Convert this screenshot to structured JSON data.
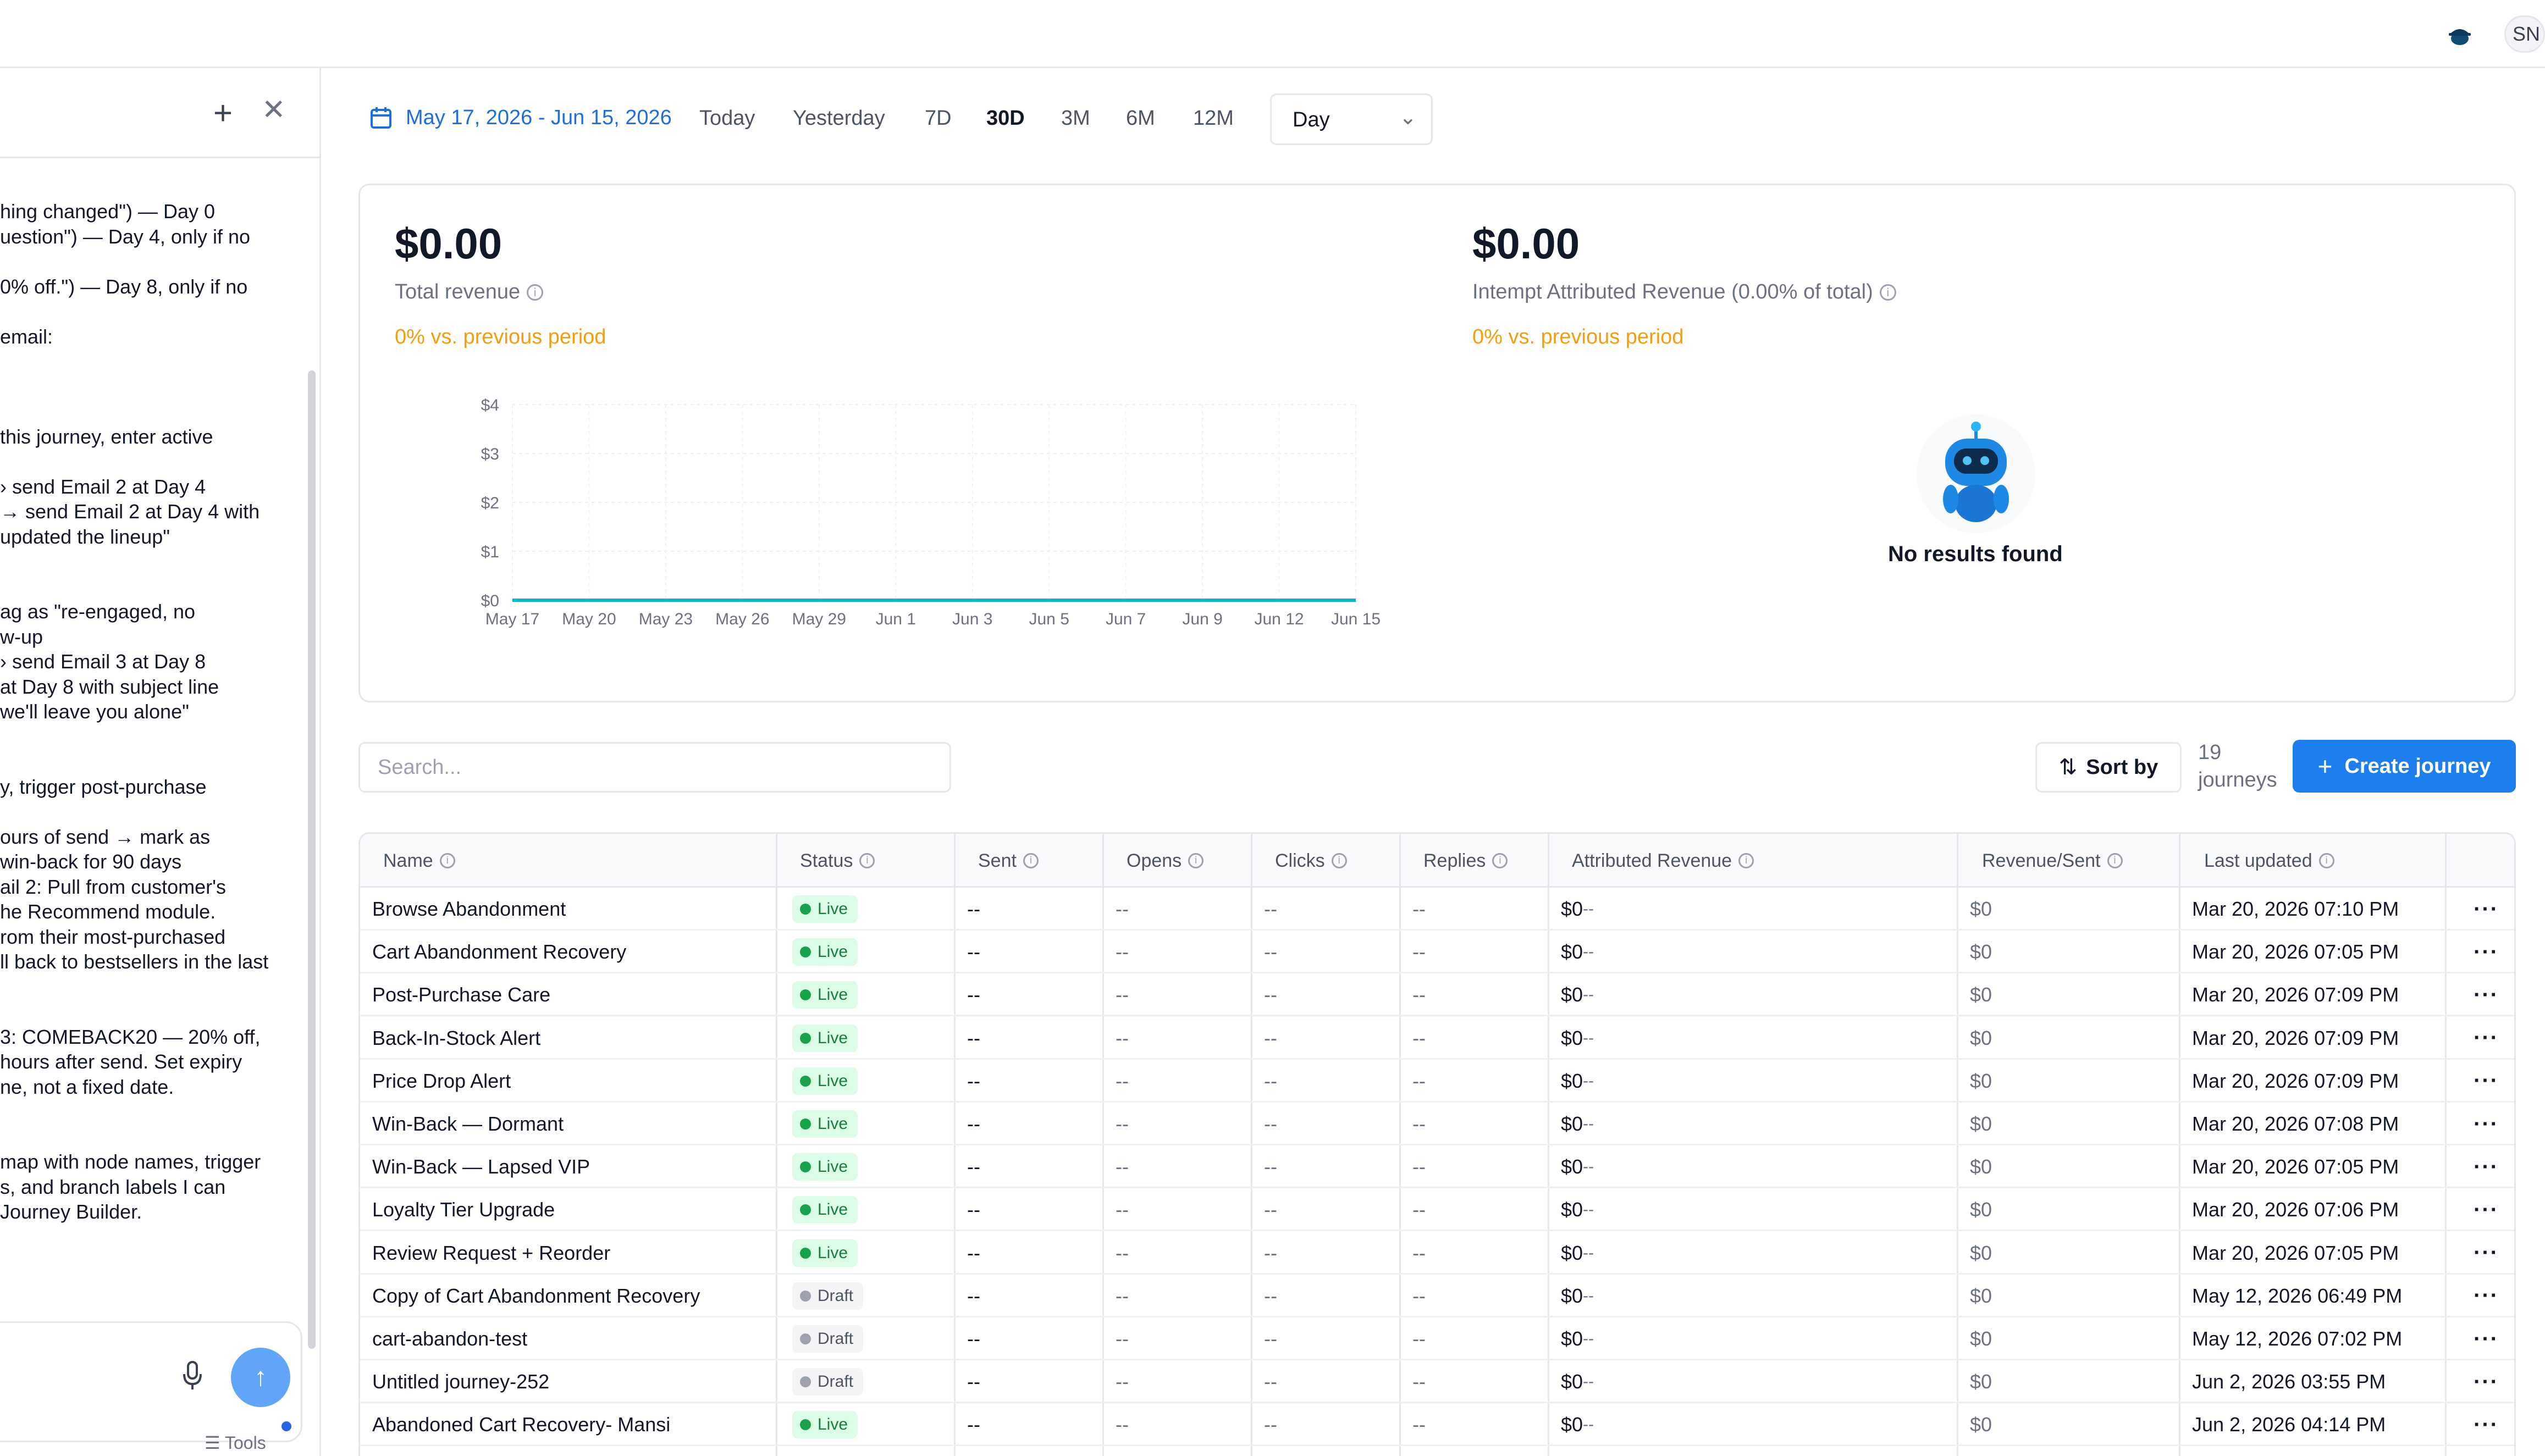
{
  "topbar": {
    "avatar_initials": "SN",
    "bot_icon": "robot-hat-icon"
  },
  "chat": {
    "new_icon": "plus-icon",
    "close_icon": "close-icon",
    "lines": [
      "hing changed\") — Day 0",
      "uestion\") — Day 4, only if no",
      "",
      "0% off.\") — Day 8, only if no",
      "",
      "email:",
      "",
      "",
      "",
      " this journey, enter active",
      "",
      "› send Email 2 at Day 4",
      "→ send Email 2 at Day 4 with",
      " updated the lineup\"",
      "",
      "",
      "ag as \"re-engaged, no",
      "w-up",
      "› send Email 3 at Day 8",
      " at Day 8 with subject line",
      "we'll leave you alone\"",
      "",
      "",
      "y, trigger post-purchase",
      "",
      "ours of send → mark as",
      " win-back for 90 days",
      "ail 2: Pull from customer's",
      "he Recommend module.",
      "rom their most-purchased",
      "ll back to bestsellers in the last",
      "",
      "",
      "3: COMEBACK20 — 20% off,",
      " hours after send. Set expiry",
      "ne, not a fixed date.",
      "",
      "",
      "map with node names, trigger",
      "s, and branch labels I can",
      " Journey Builder."
    ],
    "mic_icon": "microphone-icon",
    "send_icon": "arrow-up-icon",
    "tools_label": "Tools"
  },
  "toolbar": {
    "date_range": "May 17, 2026 - Jun 15, 2026",
    "ranges": [
      "Today",
      "Yesterday",
      "7D",
      "30D",
      "3M",
      "6M",
      "12M"
    ],
    "active_range": "30D",
    "granularity": "Day"
  },
  "stats": {
    "total_revenue": "$0.00",
    "total_revenue_label": "Total revenue",
    "total_revenue_delta": "0% vs. previous period",
    "attributed_revenue": "$0.00",
    "attributed_revenue_label": "Intempt Attributed Revenue (0.00% of total)",
    "attributed_revenue_delta": "0% vs. previous period",
    "no_results": "No results found"
  },
  "chart_data": {
    "type": "line",
    "x": [
      "May 17",
      "May 20",
      "May 23",
      "May 26",
      "May 29",
      "Jun 1",
      "Jun 3",
      "Jun 5",
      "Jun 7",
      "Jun 9",
      "Jun 12",
      "Jun 15"
    ],
    "y_ticks": [
      "$0",
      "$1",
      "$2",
      "$3",
      "$4"
    ],
    "series": [
      {
        "values": [
          0,
          0,
          0,
          0,
          0,
          0,
          0,
          0,
          0,
          0,
          0,
          0
        ]
      }
    ],
    "ylim": [
      0,
      4
    ],
    "grid": true,
    "line_color": "#06b6d4"
  },
  "search": {
    "placeholder": "Search..."
  },
  "actions": {
    "sort_label": "Sort by",
    "count_number": "19",
    "count_label": "journeys",
    "create_label": "Create journey"
  },
  "table": {
    "headers": [
      "Name",
      "Status",
      "Sent",
      "Opens",
      "Clicks",
      "Replies",
      "Attributed Revenue",
      "Revenue/Sent",
      "Last updated"
    ],
    "rows": [
      {
        "name": "Browse Abandonment",
        "status": "Live",
        "sent": "--",
        "opens": "--",
        "clicks": "--",
        "replies": "--",
        "rev": "$0",
        "rev_delta": "--",
        "rps": "$0",
        "updated": "Mar 20, 2026 07:10 PM"
      },
      {
        "name": "Cart Abandonment Recovery",
        "status": "Live",
        "sent": "--",
        "opens": "--",
        "clicks": "--",
        "replies": "--",
        "rev": "$0",
        "rev_delta": "--",
        "rps": "$0",
        "updated": "Mar 20, 2026 07:05 PM"
      },
      {
        "name": "Post-Purchase Care",
        "status": "Live",
        "sent": "--",
        "opens": "--",
        "clicks": "--",
        "replies": "--",
        "rev": "$0",
        "rev_delta": "--",
        "rps": "$0",
        "updated": "Mar 20, 2026 07:09 PM"
      },
      {
        "name": "Back-In-Stock Alert",
        "status": "Live",
        "sent": "--",
        "opens": "--",
        "clicks": "--",
        "replies": "--",
        "rev": "$0",
        "rev_delta": "--",
        "rps": "$0",
        "updated": "Mar 20, 2026 07:09 PM"
      },
      {
        "name": "Price Drop Alert",
        "status": "Live",
        "sent": "--",
        "opens": "--",
        "clicks": "--",
        "replies": "--",
        "rev": "$0",
        "rev_delta": "--",
        "rps": "$0",
        "updated": "Mar 20, 2026 07:09 PM"
      },
      {
        "name": "Win-Back — Dormant",
        "status": "Live",
        "sent": "--",
        "opens": "--",
        "clicks": "--",
        "replies": "--",
        "rev": "$0",
        "rev_delta": "--",
        "rps": "$0",
        "updated": "Mar 20, 2026 07:08 PM"
      },
      {
        "name": "Win-Back — Lapsed VIP",
        "status": "Live",
        "sent": "--",
        "opens": "--",
        "clicks": "--",
        "replies": "--",
        "rev": "$0",
        "rev_delta": "--",
        "rps": "$0",
        "updated": "Mar 20, 2026 07:05 PM"
      },
      {
        "name": "Loyalty Tier Upgrade",
        "status": "Live",
        "sent": "--",
        "opens": "--",
        "clicks": "--",
        "replies": "--",
        "rev": "$0",
        "rev_delta": "--",
        "rps": "$0",
        "updated": "Mar 20, 2026 07:06 PM"
      },
      {
        "name": "Review Request + Reorder",
        "status": "Live",
        "sent": "--",
        "opens": "--",
        "clicks": "--",
        "replies": "--",
        "rev": "$0",
        "rev_delta": "--",
        "rps": "$0",
        "updated": "Mar 20, 2026 07:05 PM"
      },
      {
        "name": "Copy of Cart Abandonment Recovery",
        "status": "Draft",
        "sent": "--",
        "opens": "--",
        "clicks": "--",
        "replies": "--",
        "rev": "$0",
        "rev_delta": "--",
        "rps": "$0",
        "updated": "May 12, 2026 06:49 PM"
      },
      {
        "name": "cart-abandon-test",
        "status": "Draft",
        "sent": "--",
        "opens": "--",
        "clicks": "--",
        "replies": "--",
        "rev": "$0",
        "rev_delta": "--",
        "rps": "$0",
        "updated": "May 12, 2026 07:02 PM"
      },
      {
        "name": "Untitled journey-252",
        "status": "Draft",
        "sent": "--",
        "opens": "--",
        "clicks": "--",
        "replies": "--",
        "rev": "$0",
        "rev_delta": "--",
        "rps": "$0",
        "updated": "Jun 2, 2026 03:55 PM"
      },
      {
        "name": "Abandoned Cart Recovery- Mansi",
        "status": "Live",
        "sent": "--",
        "opens": "--",
        "clicks": "--",
        "replies": "--",
        "rev": "$0",
        "rev_delta": "--",
        "rps": "$0",
        "updated": "Jun 2, 2026 04:14 PM"
      }
    ],
    "row_menu_icon": "more-horizontal-icon"
  },
  "colors": {
    "accent": "#1d7ef0",
    "live": "#16a34a",
    "delta": "#f59e0b"
  }
}
